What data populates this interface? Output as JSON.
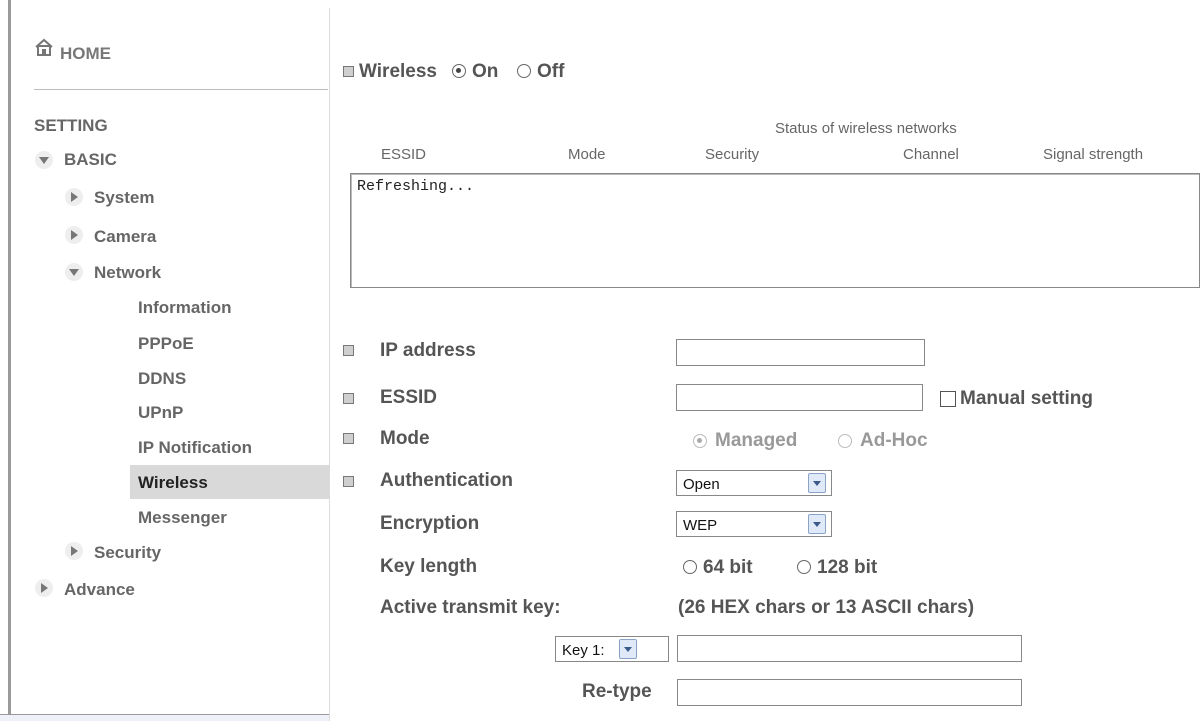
{
  "sidebar": {
    "home": "HOME",
    "setting": "SETTING",
    "basic": "BASIC",
    "system": "System",
    "camera": "Camera",
    "network": "Network",
    "network_items": [
      "Information",
      "PPPoE",
      "DDNS",
      "UPnP",
      "IP Notification",
      "Wireless",
      "Messenger"
    ],
    "security": "Security",
    "advance": "Advance"
  },
  "wireless_toggle": {
    "label": "Wireless",
    "on": "On",
    "off": "Off",
    "selected": "On"
  },
  "networks": {
    "title": "Status of wireless networks",
    "columns": [
      "ESSID",
      "Mode",
      "Security",
      "Channel",
      "Signal strength"
    ],
    "content": "Refreshing..."
  },
  "form": {
    "ip_label": "IP address",
    "ip_value": "",
    "essid_label": "ESSID",
    "essid_value": "",
    "manual_setting": "Manual setting",
    "mode_label": "Mode",
    "mode_managed": "Managed",
    "mode_adhoc": "Ad-Hoc",
    "auth_label": "Authentication",
    "auth_value": "Open",
    "enc_label": "Encryption",
    "enc_value": "WEP",
    "keylen_label": "Key length",
    "keylen_64": "64 bit",
    "keylen_128": "128 bit",
    "active_key_label": "Active transmit key:",
    "key_hint": "(26 HEX chars or 13 ASCII chars)",
    "key_select": "Key 1:",
    "key_value": "",
    "retype_label": "Re-type",
    "retype_value": ""
  }
}
